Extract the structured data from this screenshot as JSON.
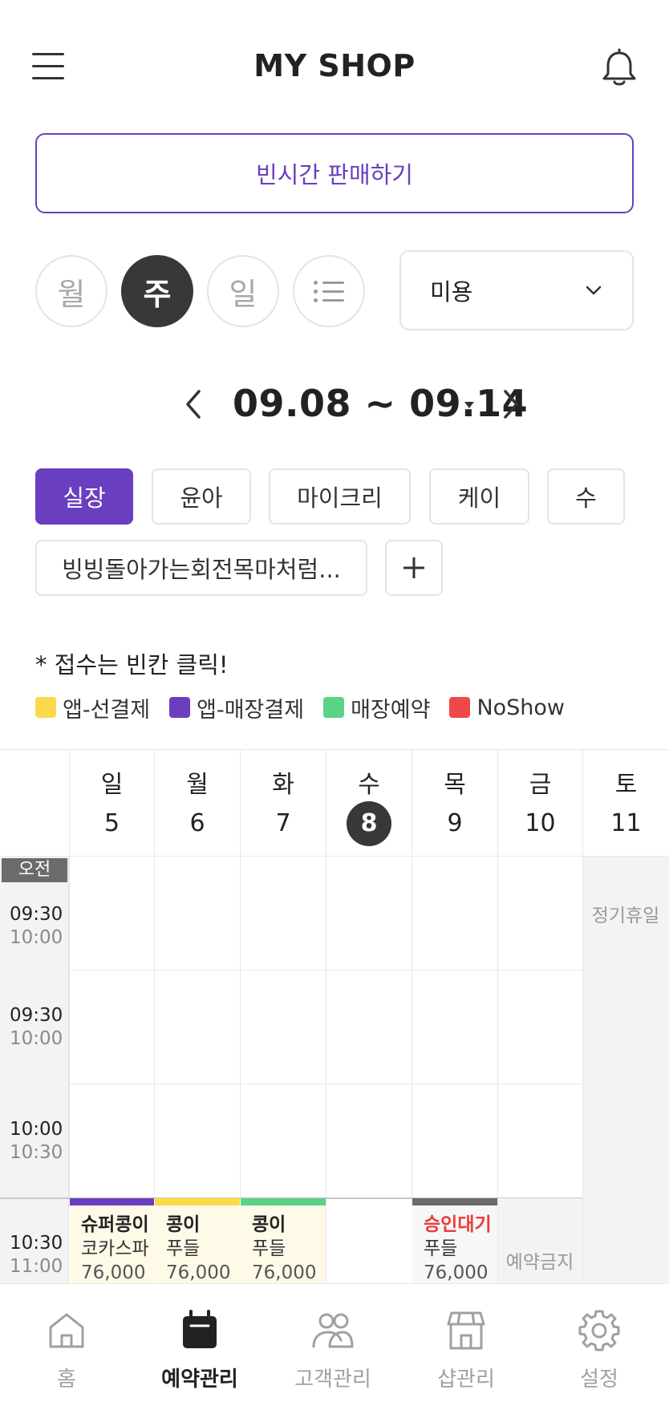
{
  "header": {
    "title": "MY SHOP",
    "menu_icon": "menu-icon",
    "bell_icon": "bell-icon"
  },
  "sell_button": "빈시간 판매하기",
  "view_modes": [
    {
      "label": "월",
      "active": false
    },
    {
      "label": "주",
      "active": true
    },
    {
      "label": "일",
      "active": false
    },
    {
      "icon": "list-icon",
      "active": false
    }
  ],
  "category_select": {
    "value": "미용"
  },
  "date_range": "09.08 ~ 09.14",
  "staff": [
    {
      "label": "실장",
      "active": true
    },
    {
      "label": "윤아"
    },
    {
      "label": "마이크리"
    },
    {
      "label": "케이"
    },
    {
      "label": "수"
    },
    {
      "label": "빙빙돌아가는회전목마처럼..."
    }
  ],
  "hint": "* 접수는 빈칸 클릭!",
  "legend": [
    {
      "label": "앱-선결제",
      "color": "#fcd94c"
    },
    {
      "label": "앱-매장결제",
      "color": "#6a3fbf"
    },
    {
      "label": "매장예약",
      "color": "#5ad384"
    },
    {
      "label": "NoShow",
      "color": "#f04848"
    }
  ],
  "calendar": {
    "days": [
      {
        "name": "일",
        "date": "5"
      },
      {
        "name": "월",
        "date": "6"
      },
      {
        "name": "화",
        "date": "7"
      },
      {
        "name": "수",
        "date": "8",
        "today": true
      },
      {
        "name": "목",
        "date": "9"
      },
      {
        "name": "금",
        "date": "10"
      },
      {
        "name": "토",
        "date": "11"
      }
    ],
    "ampm": "오전",
    "slots": [
      {
        "start": "09:30",
        "end": "10:00"
      },
      {
        "start": "09:30",
        "end": "10:00"
      },
      {
        "start": "10:00",
        "end": "10:30"
      },
      {
        "start": "10:30",
        "end": "11:00"
      }
    ],
    "closed_label": "정기휴일",
    "blocked_label": "예약금지",
    "bookings": [
      {
        "name": "슈퍼콩이",
        "service": "코카스파",
        "price": "76,000",
        "color": "#6a3fbf"
      },
      {
        "name": "콩이",
        "service": "푸들",
        "price": "76,000",
        "color": "#fcd94c"
      },
      {
        "name": "콩이",
        "service": "푸들",
        "price": "76,000",
        "color": "#5ad384"
      },
      {
        "name": "승인대기",
        "service": "푸들",
        "price": "76,000",
        "color": "#6b6b6b",
        "pending": true
      }
    ]
  },
  "nav": [
    {
      "label": "홈",
      "icon": "home-icon"
    },
    {
      "label": "예약관리",
      "icon": "calendar-icon",
      "active": true
    },
    {
      "label": "고객관리",
      "icon": "customers-icon"
    },
    {
      "label": "샵관리",
      "icon": "shop-icon"
    },
    {
      "label": "설정",
      "icon": "settings-icon"
    }
  ]
}
